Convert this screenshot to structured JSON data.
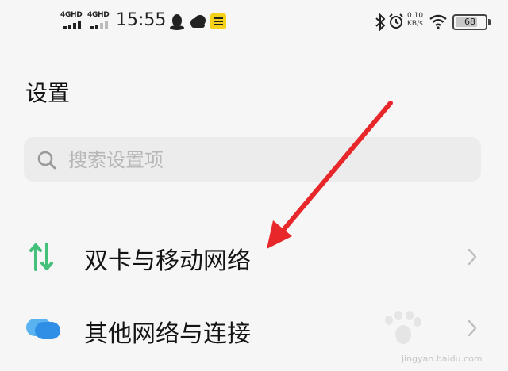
{
  "status_bar": {
    "sim1": "4GHD",
    "sim2": "4GHD",
    "time": "15:55",
    "net_rate_value": "0.10",
    "net_rate_unit": "KB/s",
    "battery": "68",
    "icons": [
      "qq-icon",
      "cloud-icon",
      "app-badge-icon",
      "bluetooth-icon",
      "alarm-icon",
      "wifi-icon",
      "battery-icon"
    ]
  },
  "page": {
    "title": "设置"
  },
  "search": {
    "placeholder": "搜索设置项"
  },
  "menu": [
    {
      "label": "双卡与移动网络",
      "icon": "dual-sim-arrows-icon"
    },
    {
      "label": "其他网络与连接",
      "icon": "cloud-bubbles-icon"
    }
  ],
  "annotation": {
    "type": "arrow",
    "color": "#e8272b"
  },
  "watermark": {
    "url": "jingyan.baidu.com",
    "brand_icon": "baidu-paw-logo"
  }
}
